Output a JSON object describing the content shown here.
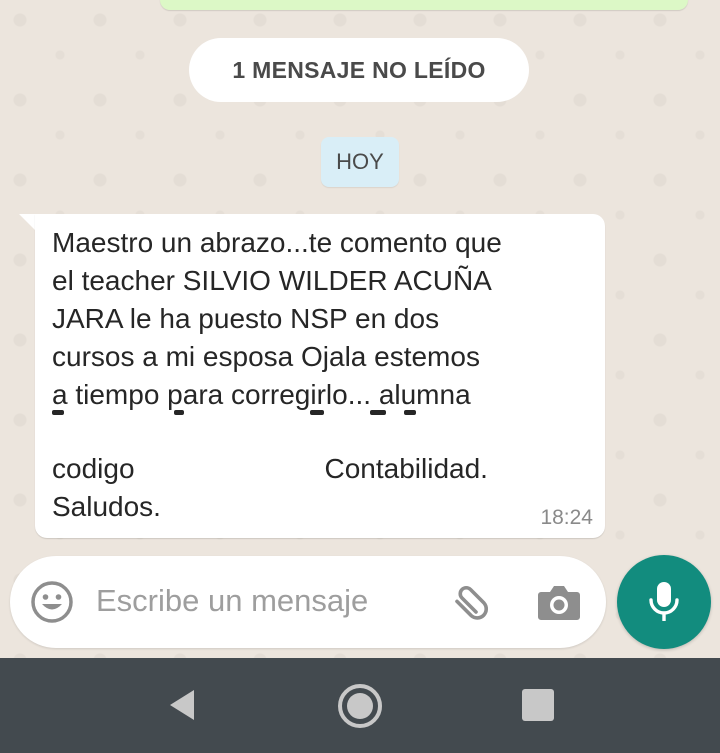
{
  "unread_banner": "1 MENSAJE NO LEÍDO",
  "date_chip": "HOY",
  "message": {
    "lines": [
      "Maestro un abrazo...te comento que",
      "el teacher SILVIO WILDER ACUÑA",
      "JARA le ha puesto NSP en dos",
      "cursos a mi esposa Ojala estemos",
      "a tiempo para corregirlo... alumna"
    ],
    "codigo_label": "codigo",
    "codigo_suffix": "Contabilidad.",
    "closing": "Saludos.",
    "time": "18:24"
  },
  "composer": {
    "placeholder": "Escribe un mensaje",
    "emoji_icon": "emoji-icon",
    "attach_icon": "paperclip-icon",
    "camera_icon": "camera-icon",
    "mic_icon": "microphone-icon"
  },
  "colors": {
    "outgoing_bubble": "#dcf8c6",
    "mic_button": "#128c7e",
    "date_chip": "#d9eef7",
    "nav_bar": "#434a4f"
  }
}
